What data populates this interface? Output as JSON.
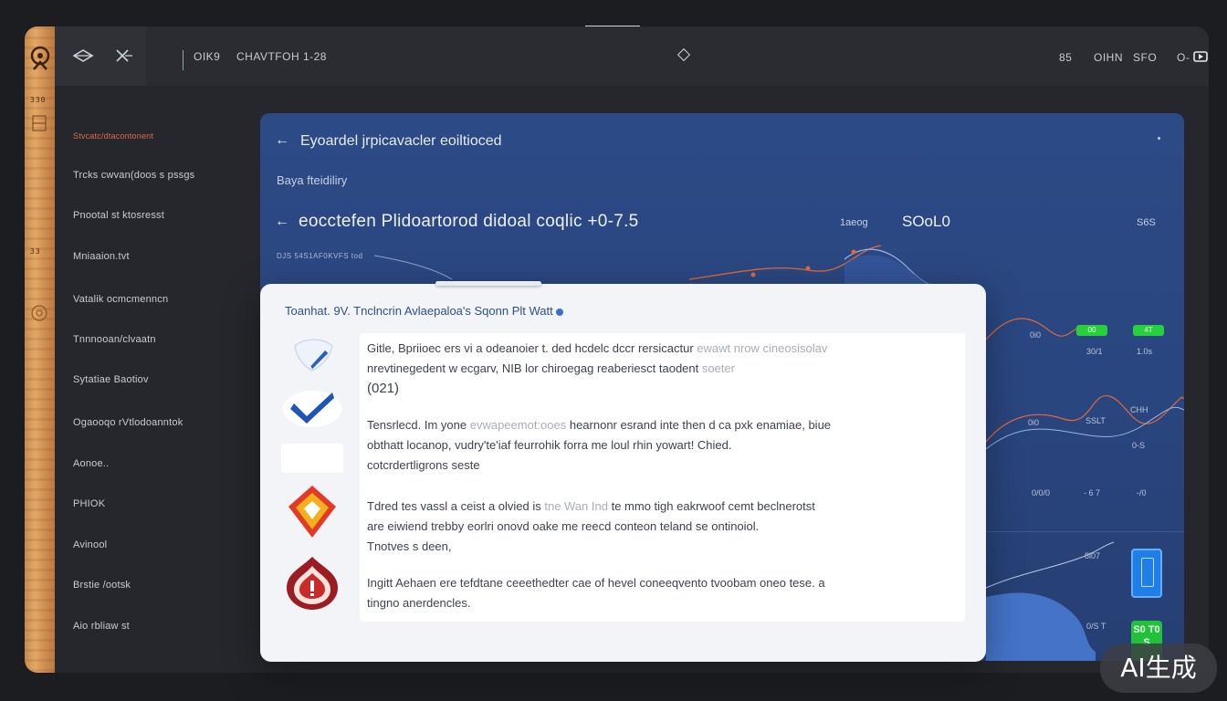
{
  "topbar": {
    "left_menu_1": "OIK9",
    "left_menu_2": "CHAVTFOH  1-28",
    "right_item_1": "85",
    "right_item_2": "OIHN",
    "right_item_3": "SFO",
    "right_item_4": "O-"
  },
  "wood": {
    "num_top": "330",
    "num_mid": "33"
  },
  "sidebar": {
    "items": [
      {
        "label": "Stvcatc/dtacontonent"
      },
      {
        "label": "Trcks cwvan(doos s pssgs"
      },
      {
        "label": "Pnootal st ktosresst"
      },
      {
        "label": "Mniaaion.tvt"
      },
      {
        "label": "Vatalik ocmcmenncn"
      },
      {
        "label": "Tnnnooan/clvaatn"
      },
      {
        "label": "Sytatiae Baotiov"
      },
      {
        "label": "Ogaooqo rVtlodoanntok"
      },
      {
        "label": "Aonoe.."
      },
      {
        "label": "PHIOK"
      },
      {
        "label": "Avinool"
      },
      {
        "label": "Brstie /ootsk"
      },
      {
        "label": "Aio rbliaw st"
      }
    ]
  },
  "main": {
    "title": "Eyoardel jrpicavacler eoiltioced",
    "subtitle": "Baya   fteidiliry",
    "heading": "eocctefen  Plidoartorod  didoal  coqlic  +0-7.5",
    "tag": "1aeog",
    "value": "SOoL0",
    "right_tag": "S6S",
    "small_label": "DJS 54S1AF0KVFS tod",
    "chart_labels": {
      "l1": "0i0",
      "l2": "30/1",
      "l3": "1.0s",
      "l4": "0i0",
      "l5": "SSLT",
      "l6": "CHH",
      "l7": "0-S",
      "l8": "0/0/0",
      "l9": "- 6 7",
      "l10": "-/0",
      "l11": "8i07",
      "l12": "0/S T"
    },
    "chips": [
      "00",
      "4T"
    ],
    "green_card_text": "S0 T0 S"
  },
  "modal": {
    "title": "Toanhat. 9V.  Tnclncrin Avlaepaloa's Sqonn Plt  Watt",
    "p1_line1": "Gitle, Bpriioec ers vi  a  odeanoier t. ded hcdelc dccr rersicactur",
    "p1_line1_faint": " ewawt nrow cineosisolav",
    "p1_line2": "nrevtinegedent  w ecgarv, NIB lor chiroegag reaberiesct taodent",
    "p1_line2_faint": "  soeter",
    "p1_line3": "(021)",
    "p2_line1": "Tensrlecd. Im yone ",
    "p2_line1_faint": "evwapeemot:ooes ",
    "p2_line1_b": "hearnonr esrand inte then d ca pxk enamiae, biue",
    "p2_line2": "obthatt locanop, vudry'te'iaf feurrohik forra me loul rhin yowart! Chied.",
    "p2_line3": "cotcrdertligrons seste",
    "p3_line1": "Tdred tes vassl a ceist a olvied is ",
    "p3_line1_faint": "tne Wan Ind",
    "p3_line1_b": " te mmo tigh  eakrwoof  cemt beclnerotst",
    "p3_line2": "are eiwiend trebby eorlri onovd oake me reecd conteon teland se ontinoiol.",
    "p3_line3": "Tnotves s deen,",
    "p4_line1": "Ingitt Aehaen ere tefdtane ceeethedter cae of hevel coneeqvento tvoobam oneo tese. a",
    "p4_line2": "tingno anerdencles."
  },
  "watermark": "AI生成",
  "colors": {
    "accent_orange": "#e0683a",
    "panel_blue": "#2c4a86",
    "chip_green": "#27d13b"
  }
}
